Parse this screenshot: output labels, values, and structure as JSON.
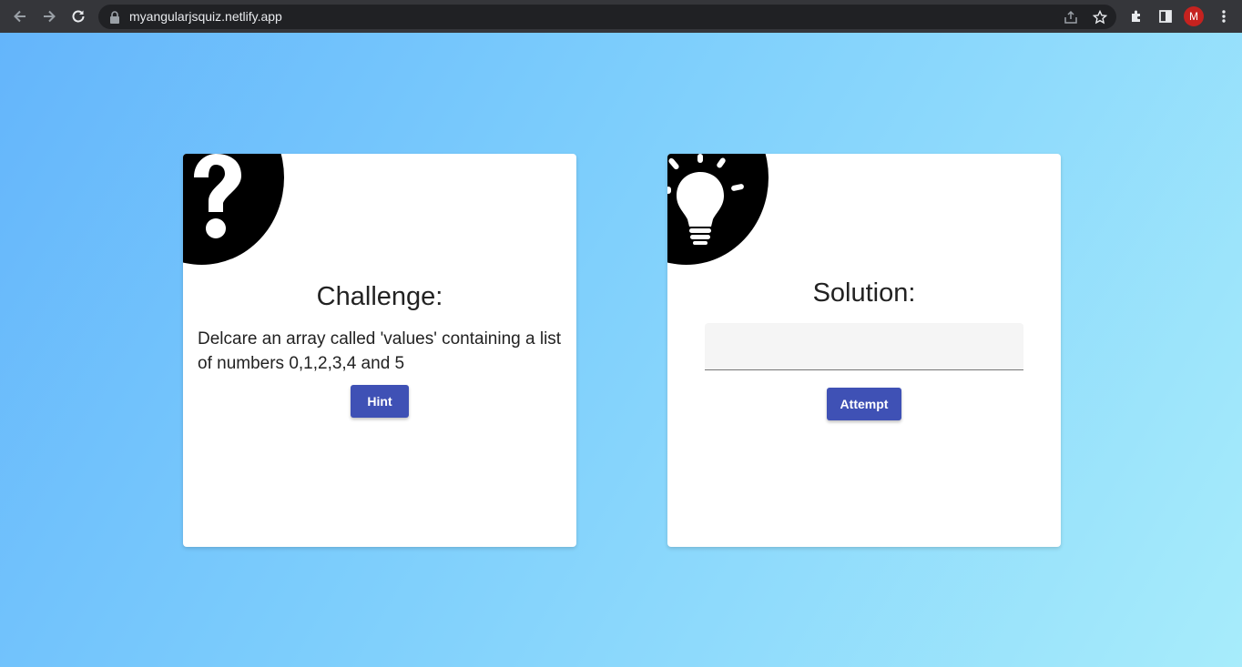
{
  "browser": {
    "url": "myangularjsquiz.netlify.app",
    "profile_initial": "M"
  },
  "challenge": {
    "title": "Challenge:",
    "text": "Delcare an array called 'values' containing a list of numbers 0,1,2,3,4 and 5",
    "hint_label": "Hint"
  },
  "solution": {
    "title": "Solution:",
    "input_value": "",
    "attempt_label": "Attempt"
  },
  "colors": {
    "button": "#3f51b5",
    "gradient_start": "#64b5fb",
    "gradient_end": "#a7ecfb"
  },
  "icons": [
    "back-icon",
    "forward-icon",
    "reload-icon",
    "lock-icon",
    "share-icon",
    "star-icon",
    "extensions-icon",
    "side-panel-icon",
    "menu-icon",
    "question-mark-icon",
    "lightbulb-icon"
  ]
}
